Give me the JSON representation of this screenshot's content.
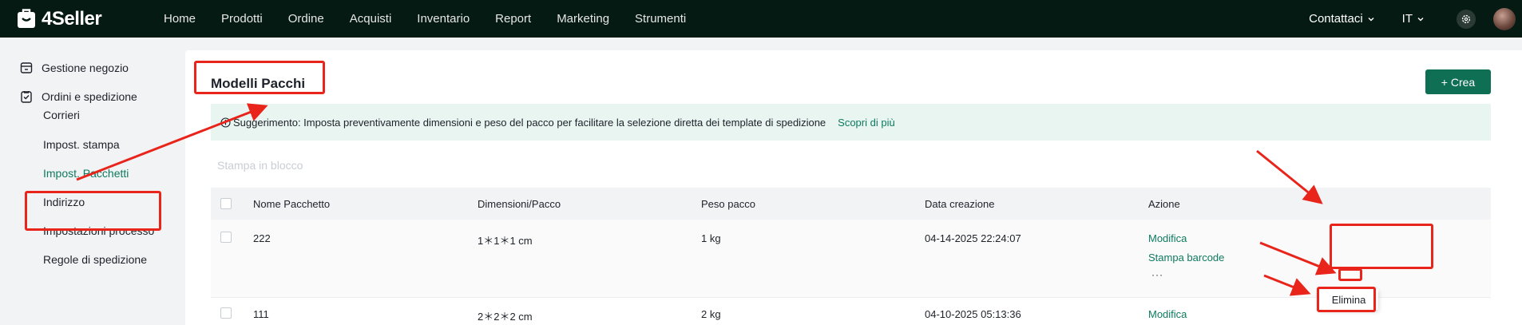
{
  "app": {
    "logo_text": "4Seller"
  },
  "nav": {
    "items": [
      "Home",
      "Prodotti",
      "Ordine",
      "Acquisti",
      "Inventario",
      "Report",
      "Marketing",
      "Strumenti"
    ],
    "contact": "Contattaci",
    "language": "IT"
  },
  "sidebar": {
    "groups": [
      "Gestione negozio",
      "Ordini e spedizione"
    ],
    "items": [
      "Corrieri",
      "Impost. stampa",
      "Impost. Pacchetti",
      "Indirizzo",
      "Impostazioni processo",
      "Regole di spedizione"
    ],
    "active_index": 2
  },
  "page": {
    "title": "Modelli Pacchi",
    "create_label": "+ Crea",
    "tip_text": "Suggerimento: Imposta preventivamente dimensioni e peso del pacco per facilitare la selezione diretta dei template di spedizione",
    "tip_link": "Scopri di più",
    "bulk_print": "Stampa in blocco"
  },
  "table": {
    "headers": [
      "Nome Pacchetto",
      "Dimensioni/Pacco",
      "Peso pacco",
      "Data creazione",
      "Azione"
    ],
    "rows": [
      {
        "name": "222",
        "dims": "1＊1＊1 cm",
        "weight": "1 kg",
        "date": "04-14-2025 22:24:07",
        "actions": [
          "Modifica",
          "Stampa barcode"
        ],
        "more": "···"
      },
      {
        "name": "111",
        "dims": "2＊2＊2 cm",
        "weight": "2 kg",
        "date": "04-10-2025 05:13:36",
        "actions": [
          "Modifica"
        ]
      }
    ],
    "dropdown_item": "Elimina"
  },
  "colors": {
    "topbar": "#061a14",
    "accent": "#0e7a5f",
    "annotation": "#e8241b"
  },
  "icons": [
    "logo-icon",
    "chevron-down-icon",
    "gear-icon",
    "store-icon",
    "clipboard-icon",
    "info-icon"
  ]
}
